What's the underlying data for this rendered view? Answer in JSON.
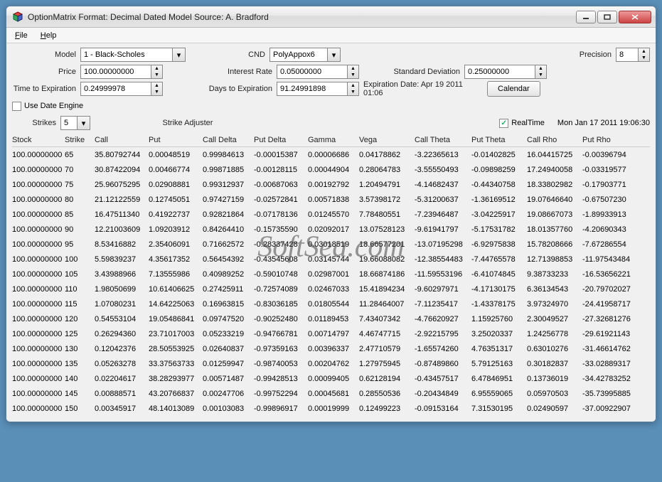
{
  "title": "OptionMatrix  Format: Decimal Dated  Model Source: A. Bradford",
  "menu": {
    "file": "File",
    "help": "Help"
  },
  "labels": {
    "model": "Model",
    "cnd": "CND",
    "precision": "Precision",
    "price": "Price",
    "interest_rate": "Interest Rate",
    "std_dev": "Standard Deviation",
    "time_exp": "Time to Expiration",
    "days_exp": "Days to Expiration",
    "exp_date": "Expiration Date: Apr 19 2011 01:06",
    "calendar": "Calendar",
    "use_date": "Use Date Engine",
    "strikes": "Strikes",
    "strike_adj": "Strike Adjuster",
    "realtime": "RealTime",
    "now": "Mon Jan 17 2011 19:06:30"
  },
  "values": {
    "model": "1 - Black-Scholes",
    "cnd": "PolyAppox6",
    "precision": "8",
    "price": "100.00000000",
    "interest_rate": "0.05000000",
    "std_dev": "0.25000000",
    "time_exp": "0.24999978",
    "days_exp": "91.24991898",
    "strikes": "5"
  },
  "checks": {
    "use_date": false,
    "realtime": true
  },
  "columns": [
    "Stock",
    "Strike",
    "Call",
    "Put",
    "Call Delta",
    "Put Delta",
    "Gamma",
    "Vega",
    "Call Theta",
    "Put Theta",
    "Call Rho",
    "Put Rho"
  ],
  "rows": [
    [
      "100.00000000",
      "65",
      "35.80792744",
      "0.00048519",
      "0.99984613",
      "-0.00015387",
      "0.00006686",
      "0.04178862",
      "-3.22365613",
      "-0.01402825",
      "16.04415725",
      "-0.00396794"
    ],
    [
      "100.00000000",
      "70",
      "30.87422094",
      "0.00466774",
      "0.99871885",
      "-0.00128115",
      "0.00044904",
      "0.28064783",
      "-3.55550493",
      "-0.09898259",
      "17.24940058",
      "-0.03319577"
    ],
    [
      "100.00000000",
      "75",
      "25.96075295",
      "0.02908881",
      "0.99312937",
      "-0.00687063",
      "0.00192792",
      "1.20494791",
      "-4.14682437",
      "-0.44340758",
      "18.33802982",
      "-0.17903771"
    ],
    [
      "100.00000000",
      "80",
      "21.12122559",
      "0.12745051",
      "0.97427159",
      "-0.02572841",
      "0.00571838",
      "3.57398172",
      "-5.31200637",
      "-1.36169512",
      "19.07646640",
      "-0.67507230"
    ],
    [
      "100.00000000",
      "85",
      "16.47511340",
      "0.41922737",
      "0.92821864",
      "-0.07178136",
      "0.01245570",
      "7.78480551",
      "-7.23946487",
      "-3.04225917",
      "19.08667073",
      "-1.89933913"
    ],
    [
      "100.00000000",
      "90",
      "12.21003609",
      "1.09203912",
      "0.84264410",
      "-0.15735590",
      "0.02092017",
      "13.07528123",
      "-9.61941797",
      "-5.17531782",
      "18.01357760",
      "-4.20690343"
    ],
    [
      "100.00000000",
      "95",
      "8.53416882",
      "2.35406091",
      "0.71662572",
      "-0.28337428",
      "0.03018519",
      "18.66577201",
      "-13.07195298",
      "-6.92975838",
      "15.78208666",
      "-7.67286554"
    ],
    [
      "100.00000000",
      "100",
      "5.59839237",
      "4.35617352",
      "0.56454392",
      "-0.43545608",
      "0.03145744",
      "19.66088082",
      "-12.38554483",
      "-7.44765578",
      "12.71398853",
      "-11.97543484"
    ],
    [
      "100.00000000",
      "105",
      "3.43988966",
      "7.13555986",
      "0.40989252",
      "-0.59010748",
      "0.02987001",
      "18.66874186",
      "-11.59553196",
      "-6.41074845",
      "9.38733233",
      "-16.53656221"
    ],
    [
      "100.00000000",
      "110",
      "1.98050699",
      "10.61406625",
      "0.27425911",
      "-0.72574089",
      "0.02467033",
      "15.41894234",
      "-9.60297971",
      "-4.17130175",
      "6.36134543",
      "-20.79702027"
    ],
    [
      "100.00000000",
      "115",
      "1.07080231",
      "14.64225063",
      "0.16963815",
      "-0.83036185",
      "0.01805544",
      "11.28464007",
      "-7.11235417",
      "-1.43378175",
      "3.97324970",
      "-24.41958717"
    ],
    [
      "100.00000000",
      "120",
      "0.54553104",
      "19.05486841",
      "0.09747520",
      "-0.90252480",
      "0.01189453",
      "7.43407342",
      "-4.76620927",
      "1.15925760",
      "2.30049527",
      "-27.32681276"
    ],
    [
      "100.00000000",
      "125",
      "0.26294360",
      "23.71017003",
      "0.05233219",
      "-0.94766781",
      "0.00714797",
      "4.46747715",
      "-2.92215795",
      "3.25020337",
      "1.24256778",
      "-29.61921143"
    ],
    [
      "100.00000000",
      "130",
      "0.12042376",
      "28.50553925",
      "0.02640837",
      "-0.97359163",
      "0.00396337",
      "2.47710579",
      "-1.65574260",
      "4.76351317",
      "0.63010276",
      "-31.46614762"
    ],
    [
      "100.00000000",
      "135",
      "0.05263278",
      "33.37563733",
      "0.01259947",
      "-0.98740053",
      "0.00204762",
      "1.27975945",
      "-0.87489860",
      "5.79125163",
      "0.30182837",
      "-33.02889317"
    ],
    [
      "100.00000000",
      "140",
      "0.02204617",
      "38.28293977",
      "0.00571487",
      "-0.99428513",
      "0.00099405",
      "0.62128194",
      "-0.43457517",
      "6.47846951",
      "0.13736019",
      "-34.42783252"
    ],
    [
      "100.00000000",
      "145",
      "0.00888571",
      "43.20766837",
      "0.00247706",
      "-0.99752294",
      "0.00045681",
      "0.28550536",
      "-0.20434849",
      "6.95559065",
      "0.05970503",
      "-35.73995885"
    ],
    [
      "100.00000000",
      "150",
      "0.00345917",
      "48.14013089",
      "0.00103083",
      "-0.99896917",
      "0.00019999",
      "0.12499223",
      "-0.09153164",
      "7.31530195",
      "0.02490597",
      "-37.00922907"
    ]
  ],
  "watermark": "SoftSea.com"
}
